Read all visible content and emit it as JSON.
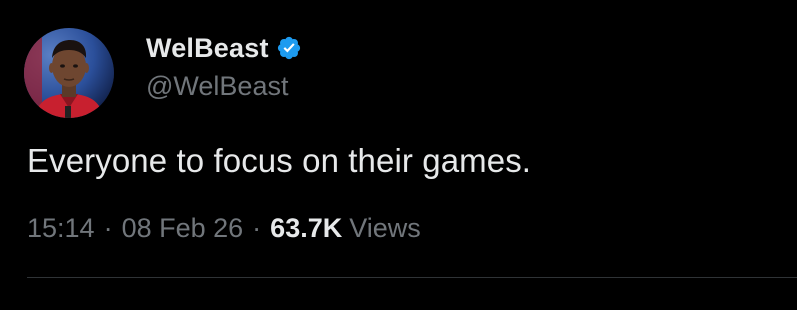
{
  "tweet": {
    "author": {
      "display_name": "WelBeast",
      "handle": "@WelBeast",
      "verified": true,
      "avatar_icon": "profile-photo"
    },
    "text": "Everyone to focus on their games.",
    "meta": {
      "time": "15:14",
      "separator": "·",
      "date": "08 Feb 26",
      "views_count": "63.7K",
      "views_label": "Views"
    }
  },
  "colors": {
    "background": "#000000",
    "primary_text": "#e7e9ea",
    "secondary_text": "#71767b",
    "verified_badge": "#1d9bf0",
    "divider": "#2f3336"
  }
}
